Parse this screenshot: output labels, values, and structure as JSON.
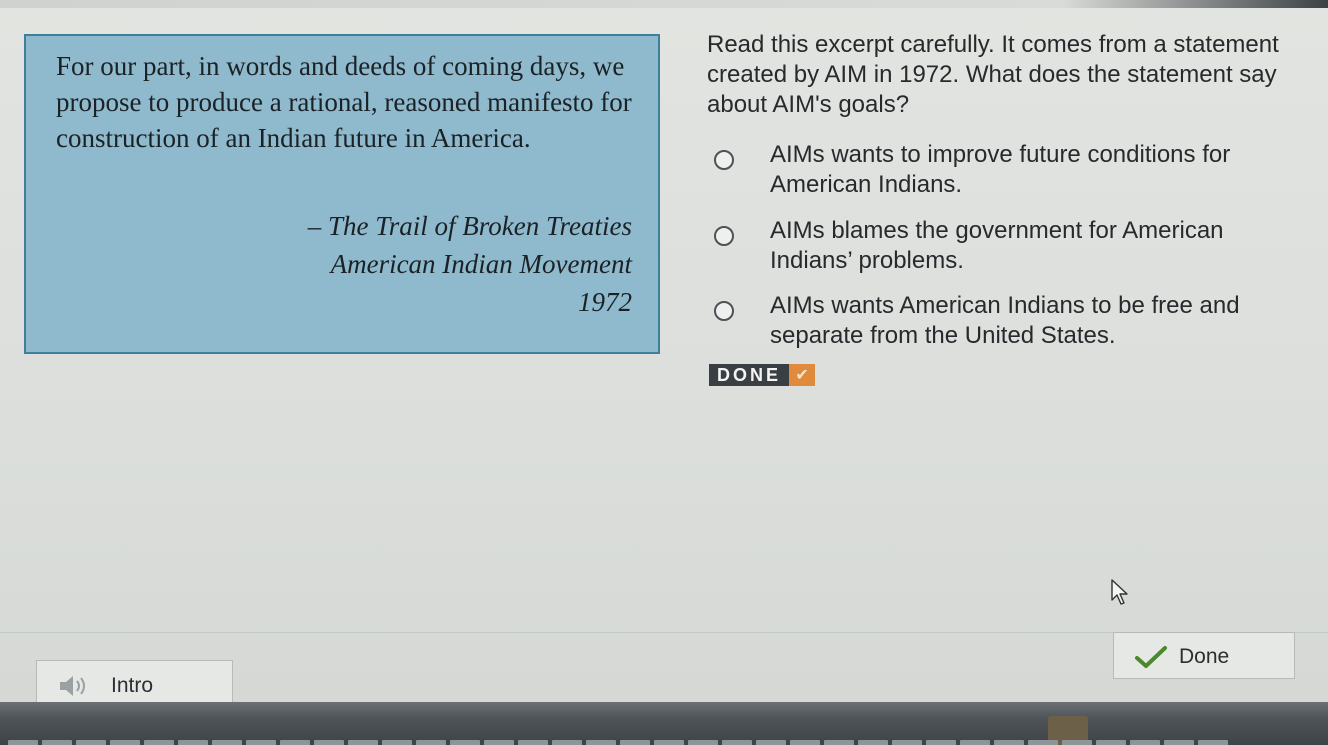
{
  "excerpt": {
    "text": "For our part, in words and deeds of coming days, we propose to produce a rational, reasoned manifesto for construction of an Indian future in America.",
    "attribution_title": "– The Trail of Broken Treaties",
    "attribution_org": "American Indian Movement",
    "attribution_year": "1972"
  },
  "question": {
    "prompt": "Read this excerpt carefully. It comes from a statement created by AIM in 1972. What does the statement say about AIM's goals?",
    "options": [
      {
        "label": "AIMs wants to improve future conditions for American Indians.",
        "selected": false
      },
      {
        "label": "AIMs blames the government for American Indians’ problems.",
        "selected": false
      },
      {
        "label": "AIMs wants American Indians to be free and separate from the United States.",
        "selected": false
      }
    ]
  },
  "status_badge": {
    "label": "DONE",
    "icon": "checkmark-icon",
    "accent": "#e08a3c"
  },
  "footer": {
    "intro_label": "Intro",
    "intro_icon": "speaker-icon",
    "done_label": "Done",
    "done_icon": "checkmark-icon",
    "done_icon_color": "#4a8a2a"
  },
  "colors": {
    "excerpt_bg": "#8fb9cc",
    "excerpt_border": "#3f7f9a",
    "bottom_bar": "#4d5357"
  }
}
